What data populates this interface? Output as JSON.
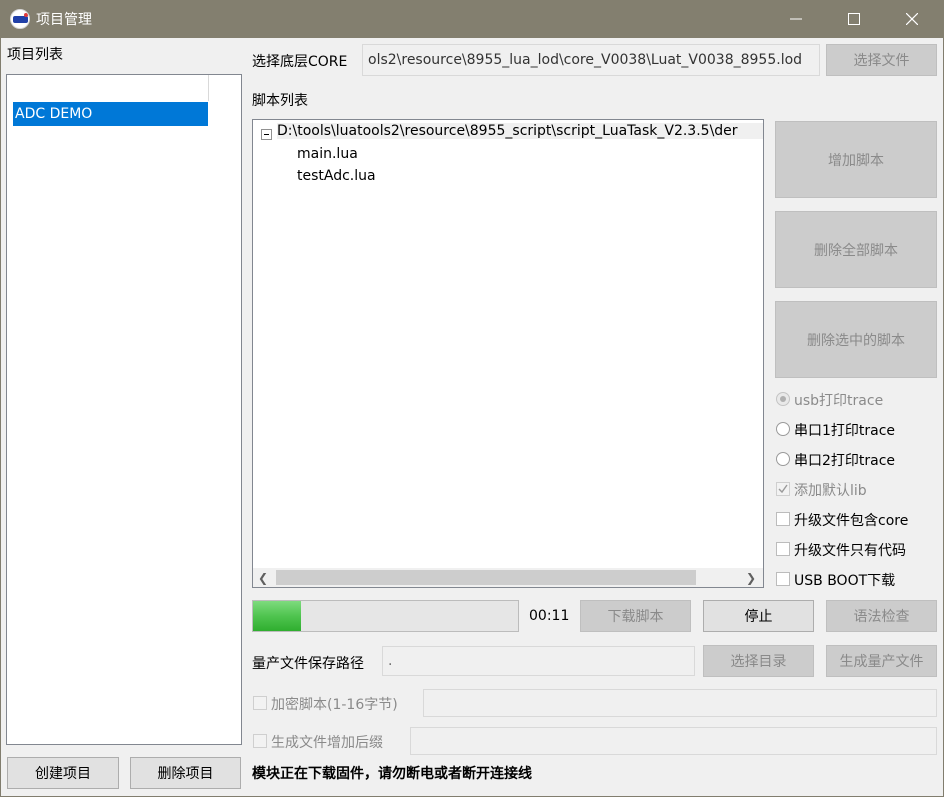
{
  "window": {
    "title": "项目管理",
    "accent": "#0078d7",
    "progress_fill": "#4fc44f"
  },
  "project_list": {
    "label": "项目列表",
    "items": [
      "ADC DEMO"
    ],
    "create_label": "创建项目",
    "delete_label": "删除项目"
  },
  "core": {
    "label": "选择底层CORE",
    "value": "ols2\\resource\\8955_lua_lod\\core_V0038\\Luat_V0038_8955.lod",
    "choose_label": "选择文件"
  },
  "scripts": {
    "label": "脚本列表",
    "root": "D:\\tools\\luatools2\\resource\\8955_script\\script_LuaTask_V2.3.5\\der",
    "files": [
      "main.lua",
      "testAdc.lua"
    ],
    "add_label": "增加脚本",
    "delete_all_label": "删除全部脚本",
    "delete_selected_label": "删除选中的脚本"
  },
  "options": {
    "usb_trace": "usb打印trace",
    "uart1_trace": "串口1打印trace",
    "uart2_trace": "串口2打印trace",
    "default_lib": "添加默认lib",
    "include_core": "升级文件包含core",
    "only_code": "升级文件只有代码",
    "usb_boot": "USB BOOT下载"
  },
  "download": {
    "progress": 0.18,
    "elapsed": "00:11",
    "download_label": "下载脚本",
    "stop_label": "停止",
    "syntax_label": "语法检查"
  },
  "production": {
    "path_label": "量产文件保存路径",
    "path_value": ".",
    "choose_dir_label": "选择目录",
    "generate_label": "生成量产文件"
  },
  "encrypt": {
    "label": "加密脚本(1-16字节)",
    "value": ""
  },
  "suffix": {
    "label": "生成文件增加后缀",
    "value": ""
  },
  "status": "模块正在下载固件，请勿断电或者断开连接线"
}
